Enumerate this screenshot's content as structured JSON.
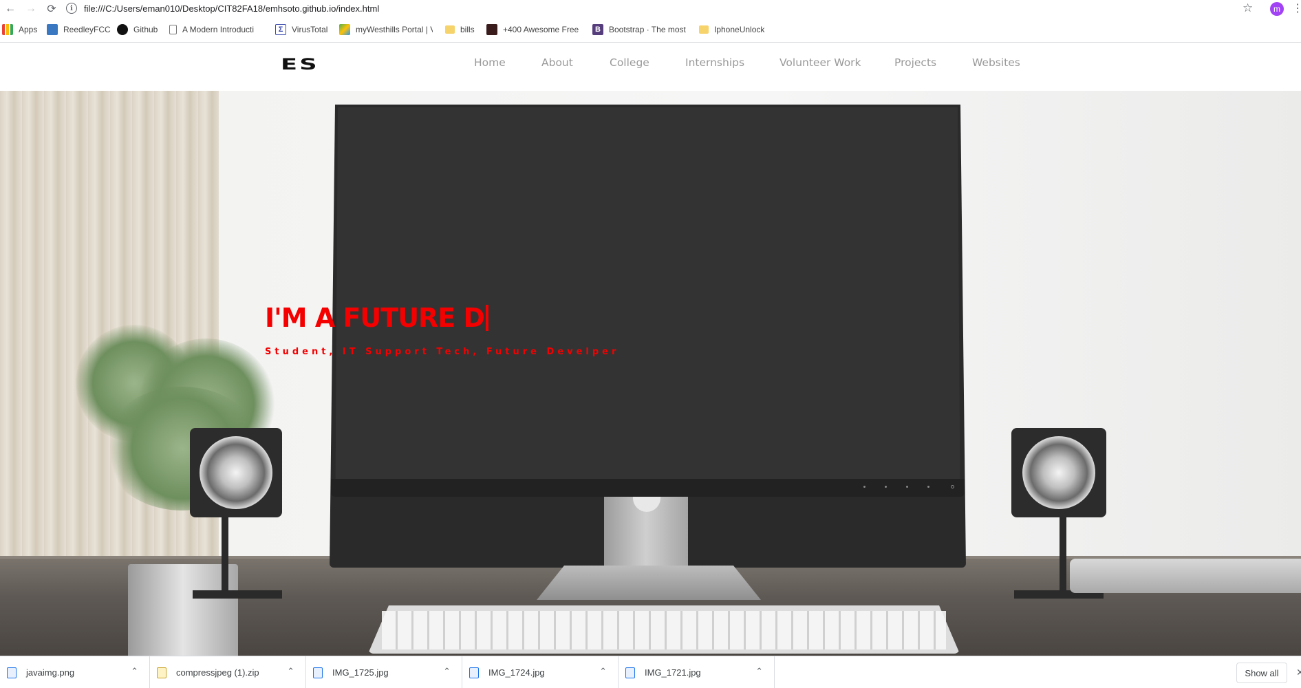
{
  "browser": {
    "url": "file:///C:/Users/eman010/Desktop/CIT82FA18/emhsoto.github.io/index.html",
    "profile_initial": "m",
    "back_icon": "←",
    "forward_icon": "→",
    "reload_icon": "⟳",
    "info_icon": "i",
    "star_icon": "☆",
    "menu_icon": "⋮"
  },
  "bookmarks": [
    {
      "label": "Apps",
      "icon": "apps-grid-icon"
    },
    {
      "label": "ReedleyFCC",
      "icon": "reedley-icon"
    },
    {
      "label": "Github",
      "icon": "github-icon"
    },
    {
      "label": "A Modern Introducti",
      "icon": "page-icon"
    },
    {
      "label": "VirusTotal",
      "icon": "virustotal-icon"
    },
    {
      "label": "myWesthills Portal | V",
      "icon": "westhills-icon"
    },
    {
      "label": "bills",
      "icon": "folder-icon"
    },
    {
      "label": "+400 Awesome Free",
      "icon": "awesome-icon"
    },
    {
      "label": "Bootstrap · The most",
      "icon": "bootstrap-icon"
    },
    {
      "label": "IphoneUnlock",
      "icon": "folder-icon"
    }
  ],
  "site": {
    "logo": "ES",
    "nav": [
      "Home",
      "About",
      "College",
      "Internships",
      "Volunteer Work",
      "Projects",
      "Websites"
    ],
    "hero_title": "I'M A FUTURE D",
    "hero_subtitle": "Student, IT Support Tech, Future Develper",
    "accent_color": "#f40000"
  },
  "downloads": [
    {
      "name": "javaimg.png",
      "type": "image"
    },
    {
      "name": "compressjpeg (1).zip",
      "type": "zip"
    },
    {
      "name": "IMG_1725.jpg",
      "type": "image"
    },
    {
      "name": "IMG_1724.jpg",
      "type": "image"
    },
    {
      "name": "IMG_1721.jpg",
      "type": "image"
    }
  ],
  "download_shelf": {
    "show_all_label": "Show all",
    "chevron_icon": "⌃",
    "close_icon": "✕"
  }
}
